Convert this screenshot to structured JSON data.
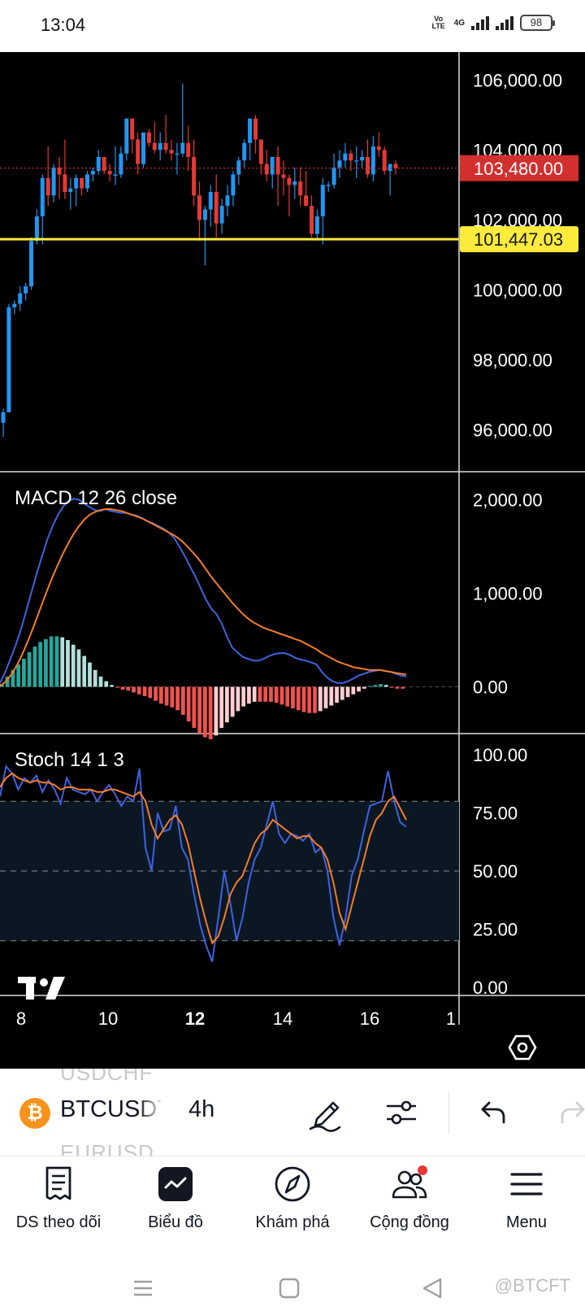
{
  "status_bar": {
    "time": "13:04",
    "volte_line1": "Vo",
    "volte_line2": "LTE",
    "network": "4G",
    "battery": "98"
  },
  "chart": {
    "price_axis": [
      "106,000.00",
      "104,000.00",
      "102,000.00",
      "100,000.00",
      "98,000.00",
      "96,000.00"
    ],
    "current_price": "103,480.00",
    "current_price_color": "#d32f2f",
    "horizontal_line_price": "101,447.03",
    "horizontal_line_color": "#ffeb3b",
    "up_color": "#2196f3",
    "down_color": "#e53935",
    "time_axis": [
      "8",
      "10",
      "12",
      "14",
      "16",
      "1"
    ],
    "time_axis_bold": "12"
  },
  "macd": {
    "title": "MACD 12 26 close",
    "axis": [
      "2,000.00",
      "1,000.00",
      "0.00"
    ],
    "macd_color": "#3f62e0",
    "signal_color": "#f57c29"
  },
  "stoch": {
    "title": "Stoch 14 1 3",
    "axis": [
      "100.00",
      "75.00",
      "50.00",
      "25.00",
      "0.00"
    ],
    "k_color": "#3f62e0",
    "d_color": "#f57c29"
  },
  "chart_data": [
    {
      "type": "candlestick",
      "title": "",
      "xlabel": "",
      "ylabel": "",
      "ylim": [
        94800,
        106800
      ],
      "x_ticks": [
        "8",
        "10",
        "12",
        "14",
        "16",
        "1"
      ],
      "candles": [
        [
          96200,
          96600,
          95800,
          96500
        ],
        [
          96500,
          99600,
          96500,
          99500
        ],
        [
          99500,
          99700,
          99300,
          99600
        ],
        [
          99600,
          100100,
          99400,
          99900
        ],
        [
          99900,
          100200,
          99700,
          100100
        ],
        [
          100100,
          101500,
          100000,
          101400
        ],
        [
          101400,
          102300,
          101300,
          102100
        ],
        [
          102100,
          103300,
          101300,
          103200
        ],
        [
          103200,
          104100,
          102400,
          102700
        ],
        [
          102700,
          103600,
          102500,
          103500
        ],
        [
          103500,
          103800,
          102600,
          103300
        ],
        [
          103300,
          104300,
          102600,
          102800
        ],
        [
          102800,
          103200,
          102300,
          102900
        ],
        [
          102900,
          103300,
          102400,
          103200
        ],
        [
          103200,
          103200,
          102700,
          102900
        ],
        [
          102900,
          103400,
          102800,
          103300
        ],
        [
          103300,
          103500,
          103100,
          103400
        ],
        [
          103400,
          104000,
          103300,
          103800
        ],
        [
          103800,
          103800,
          103300,
          103400
        ],
        [
          103400,
          103600,
          103100,
          103300
        ],
        [
          103300,
          104100,
          103000,
          103300
        ],
        [
          103300,
          104100,
          103200,
          103900
        ],
        [
          103900,
          104900,
          103700,
          104900
        ],
        [
          104900,
          104900,
          103900,
          104300
        ],
        [
          104300,
          104500,
          103300,
          103600
        ],
        [
          103600,
          104400,
          103500,
          104500
        ],
        [
          104500,
          104600,
          104100,
          104200
        ],
        [
          104200,
          104800,
          103900,
          104000
        ],
        [
          104000,
          104500,
          103700,
          104200
        ],
        [
          104200,
          105000,
          103900,
          104000
        ],
        [
          104000,
          104300,
          103700,
          103900
        ],
        [
          103900,
          104200,
          103300,
          103900
        ],
        [
          103900,
          105900,
          103800,
          104200
        ],
        [
          104200,
          104700,
          103400,
          103800
        ],
        [
          103800,
          104300,
          102400,
          102700
        ],
        [
          102700,
          103100,
          101400,
          102000
        ],
        [
          102000,
          102400,
          100700,
          102300
        ],
        [
          102300,
          103000,
          101800,
          102800
        ],
        [
          102800,
          103300,
          101500,
          101900
        ],
        [
          101900,
          102600,
          101600,
          102400
        ],
        [
          102400,
          103000,
          102100,
          102700
        ],
        [
          102700,
          103400,
          102400,
          103300
        ],
        [
          103300,
          103800,
          103000,
          103700
        ],
        [
          103700,
          104300,
          103500,
          104200
        ],
        [
          104200,
          104800,
          103700,
          104900
        ],
        [
          104900,
          105000,
          103900,
          104300
        ],
        [
          104300,
          104300,
          103300,
          103600
        ],
        [
          103600,
          104000,
          103100,
          103300
        ],
        [
          103300,
          103700,
          102900,
          103800
        ],
        [
          103800,
          104100,
          102400,
          103300
        ],
        [
          103300,
          103700,
          102700,
          103200
        ],
        [
          103200,
          103300,
          102100,
          103000
        ],
        [
          103000,
          103500,
          102600,
          103100
        ],
        [
          103100,
          103500,
          102400,
          102700
        ],
        [
          102700,
          103400,
          102400,
          102400
        ],
        [
          102400,
          102700,
          101500,
          101600
        ],
        [
          101600,
          102300,
          101400,
          102100
        ],
        [
          102100,
          103200,
          101300,
          103000
        ],
        [
          103000,
          103100,
          102800,
          103000
        ],
        [
          103000,
          103900,
          102900,
          103500
        ],
        [
          103500,
          104000,
          103200,
          103700
        ],
        [
          103700,
          104200,
          103500,
          103900
        ],
        [
          103900,
          104000,
          103400,
          103700
        ],
        [
          103700,
          104100,
          103200,
          103700
        ],
        [
          103700,
          104000,
          103500,
          103800
        ],
        [
          103800,
          104300,
          103200,
          103300
        ],
        [
          103300,
          104400,
          103100,
          104100
        ],
        [
          104100,
          104500,
          103800,
          104000
        ],
        [
          104000,
          104100,
          103300,
          103400
        ],
        [
          103400,
          103600,
          102700,
          103600
        ],
        [
          103600,
          103700,
          103300,
          103480
        ]
      ]
    },
    {
      "type": "line",
      "title": "MACD 12 26 close",
      "ylim": [
        -500,
        2300
      ],
      "series": [
        {
          "values": [
            40,
            160,
            300,
            450,
            620,
            820,
            1020,
            1220,
            1400,
            1580,
            1720,
            1840,
            1930,
            1990,
            2010,
            2000,
            1960,
            1920,
            1890,
            1880,
            1900,
            1880,
            1870,
            1860,
            1860,
            1840,
            1830,
            1800,
            1770,
            1750,
            1720,
            1690,
            1650,
            1590,
            1500,
            1400,
            1290,
            1180,
            1060,
            940,
            840,
            780,
            680,
            540,
            420,
            370,
            320,
            300,
            280,
            280,
            300,
            330,
            350,
            360,
            360,
            340,
            310,
            290,
            280,
            260,
            240,
            160,
            100,
            60,
            40,
            40,
            60,
            90,
            120,
            140,
            160,
            170,
            180,
            170,
            160,
            140,
            120,
            110
          ],
          "name": ""
        },
        {
          "values": [
            10,
            50,
            120,
            210,
            320,
            450,
            590,
            740,
            890,
            1040,
            1180,
            1310,
            1430,
            1540,
            1640,
            1720,
            1790,
            1840,
            1870,
            1890,
            1900,
            1900,
            1890,
            1880,
            1860,
            1840,
            1820,
            1800,
            1770,
            1740,
            1710,
            1680,
            1650,
            1620,
            1580,
            1530,
            1470,
            1410,
            1340,
            1260,
            1180,
            1110,
            1040,
            970,
            900,
            840,
            780,
            730,
            690,
            660,
            630,
            610,
            590,
            570,
            550,
            530,
            510,
            490,
            460,
            430,
            400,
            360,
            330,
            300,
            270,
            250,
            230,
            210,
            200,
            190,
            180,
            180,
            180,
            170,
            160,
            150,
            140,
            130
          ],
          "name": ""
        }
      ],
      "histogram": [
        30,
        110,
        180,
        240,
        300,
        370,
        430,
        480,
        510,
        540,
        540,
        530,
        500,
        450,
        400,
        330,
        260,
        180,
        110,
        60,
        20,
        -10,
        -30,
        -40,
        -60,
        -80,
        -100,
        -120,
        -150,
        -180,
        -200,
        -220,
        -250,
        -300,
        -370,
        -440,
        -500,
        -540,
        -560,
        -520,
        -440,
        -380,
        -320,
        -260,
        -210,
        -180,
        -160,
        -160,
        -160,
        -160,
        -170,
        -190,
        -210,
        -230,
        -250,
        -270,
        -280,
        -280,
        -260,
        -230,
        -200,
        -170,
        -140,
        -110,
        -80,
        -50,
        -20,
        10,
        20,
        30,
        20,
        -10,
        -20,
        -20
      ]
    },
    {
      "type": "line",
      "title": "Stoch 14 1 3",
      "ylim": [
        0,
        100
      ],
      "series": [
        {
          "values": [
            82,
            95,
            92,
            85,
            90,
            88,
            91,
            84,
            89,
            85,
            79,
            90,
            85,
            84,
            83,
            85,
            80,
            84,
            87,
            83,
            78,
            82,
            80,
            94,
            60,
            50,
            75,
            67,
            68,
            78,
            60,
            55,
            40,
            27,
            18,
            11,
            30,
            50,
            36,
            20,
            30,
            45,
            55,
            60,
            70,
            80,
            66,
            62,
            66,
            65,
            63,
            66,
            58,
            60,
            50,
            30,
            18,
            30,
            48,
            55,
            67,
            78,
            79,
            80,
            93,
            80,
            71,
            69
          ],
          "name": ""
        },
        {
          "values": [
            86,
            90,
            92,
            90,
            89,
            88,
            89,
            88,
            88,
            87,
            85,
            86,
            86,
            85,
            85,
            85,
            84,
            84,
            85,
            85,
            84,
            83,
            82,
            84,
            80,
            70,
            64,
            68,
            72,
            74,
            70,
            62,
            50,
            38,
            28,
            19,
            22,
            30,
            40,
            45,
            48,
            55,
            62,
            66,
            68,
            72,
            70,
            68,
            66,
            64,
            65,
            65,
            62,
            60,
            55,
            45,
            32,
            25,
            35,
            45,
            55,
            65,
            72,
            75,
            80,
            82,
            77,
            72
          ],
          "name": ""
        }
      ],
      "levels": [
        80,
        50,
        20
      ]
    }
  ],
  "toolbar": {
    "ghost_symbol_above": "USDCHF",
    "symbol": "BTCUSDT",
    "ghost_symbol_below": "EURUSD",
    "coin_letter": "₿",
    "interval": "4h"
  },
  "bottom_nav": {
    "watchlist": "DS theo dõi",
    "chart": "Biểu đồ",
    "explore": "Khám phá",
    "community": "Cộng đồng",
    "menu": "Menu"
  },
  "watermark": "@BTCFT"
}
